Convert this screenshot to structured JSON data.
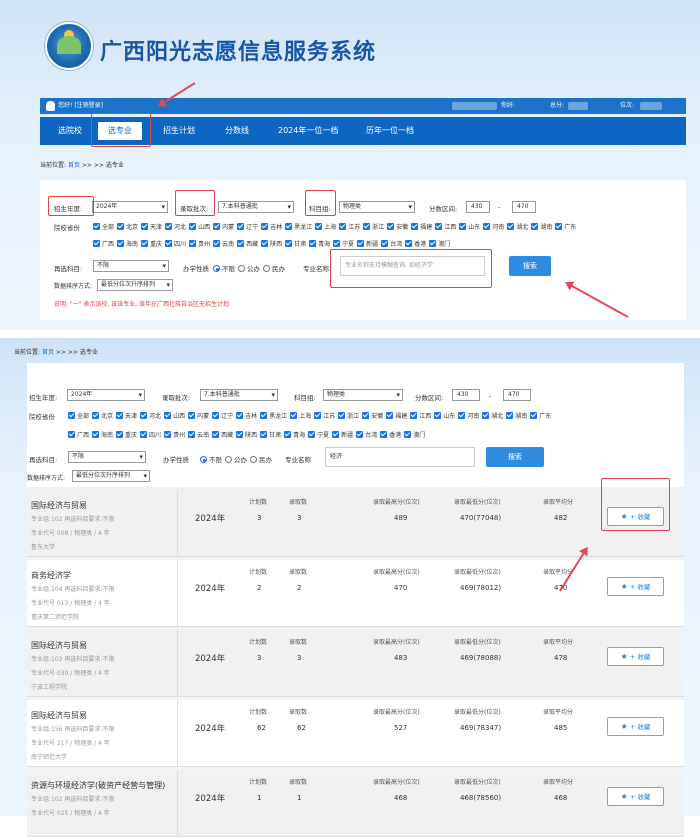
{
  "header": {
    "system_title": "广西阳光志愿信息服务系统",
    "user_text": "您好! [注销登录]",
    "labels": [
      "你好:",
      "总分:",
      "位次:"
    ]
  },
  "nav": [
    "选院校",
    "选专业",
    "招生计划",
    "分数线",
    "2024年一位一档",
    "历年一位一档"
  ],
  "breadcrumb": {
    "prefix": "当前位置:",
    "home": "首页",
    "rest": ">> >> 选专业"
  },
  "filters": {
    "year_label": "招生年度:",
    "year_value": "2024年",
    "batch_label": "录取批次:",
    "batch_value": "7.本科普通批",
    "subject_label": "科目组:",
    "subject_value": "物理类",
    "range_label": "分数区间:",
    "range_from": "430",
    "range_dash": "-",
    "range_to": "470",
    "province_label": "院校省份",
    "provinces_row1": [
      "全部",
      "北京",
      "天津",
      "河北",
      "山西",
      "内蒙",
      "辽宁",
      "吉林",
      "黑龙江",
      "上海",
      "江苏",
      "浙江",
      "安徽",
      "福建",
      "江西",
      "山东",
      "河南",
      "湖北",
      "湖南",
      "广东"
    ],
    "provinces_row2": [
      "广西",
      "海南",
      "重庆",
      "四川",
      "贵州",
      "云南",
      "西藏",
      "陕西",
      "甘肃",
      "青海",
      "宁夏",
      "新疆",
      "台湾",
      "香港",
      "澳门"
    ],
    "reselect_label": "再选科目:",
    "reselect_value": "不限",
    "nature_label": "办学性质",
    "nature_options": [
      "不限",
      "公办",
      "民办"
    ],
    "major_label": "专业名称",
    "search_placeholder": "专业名称支持模糊查询, 如经济学",
    "search_value2": "经济",
    "search_button": "搜索",
    "sort_label": "数据排序方式:",
    "sort_value": "最低分位次升序排列",
    "note": "说明: \"一\" 表示该校, 该该专业, 该年在广西壮族自治区无招生计划"
  },
  "table_headers": {
    "plan": "计划数",
    "admit": "录取数",
    "max": "录取最高分(位次)",
    "min": "录取最低分(位次)",
    "avg": "录取平均分"
  },
  "fav_label": "+ 收藏",
  "rows": [
    {
      "name": "国际经济与贸易",
      "line1": "专业组:102    再选科目要求:不限",
      "line2": "专业代号 008 / 物理类 / 4 年",
      "school": "鲁东大学",
      "year": "2024年",
      "plan": "3",
      "admit": "3",
      "max": "489",
      "min": "470(77048)",
      "avg": "482"
    },
    {
      "name": "商务经济学",
      "line1": "专业组:104    再选科目要求:不限",
      "line2": "专业代号 013 / 物理类 / 4 年",
      "school": "重庆第二师范学院",
      "year": "2024年",
      "plan": "2",
      "admit": "2",
      "max": "470",
      "min": "469(78012)",
      "avg": "470"
    },
    {
      "name": "国际经济与贸易",
      "line1": "专业组:103    再选科目要求:不限",
      "line2": "专业代号 030 / 物理类 / 4 年",
      "school": "宁波工程学院",
      "year": "2024年",
      "plan": "3",
      "admit": "3",
      "max": "483",
      "min": "469(78088)",
      "avg": "478"
    },
    {
      "name": "国际经济与贸易",
      "line1": "专业组:156    再选科目要求:不限",
      "line2": "专业代号 217 / 物理类 / 4 年",
      "school": "南宁师范大学",
      "year": "2024年",
      "plan": "62",
      "admit": "62",
      "max": "527",
      "min": "469(78347)",
      "avg": "485"
    },
    {
      "name": "资源与环境经济学(破资产经营与管理)",
      "line1": "专业组:102    再选科目要求:不限",
      "line2": "专业代号 025 / 物理类 / 4 年",
      "school": "",
      "year": "2024年",
      "plan": "1",
      "admit": "1",
      "max": "468",
      "min": "468(78560)",
      "avg": "468"
    }
  ]
}
